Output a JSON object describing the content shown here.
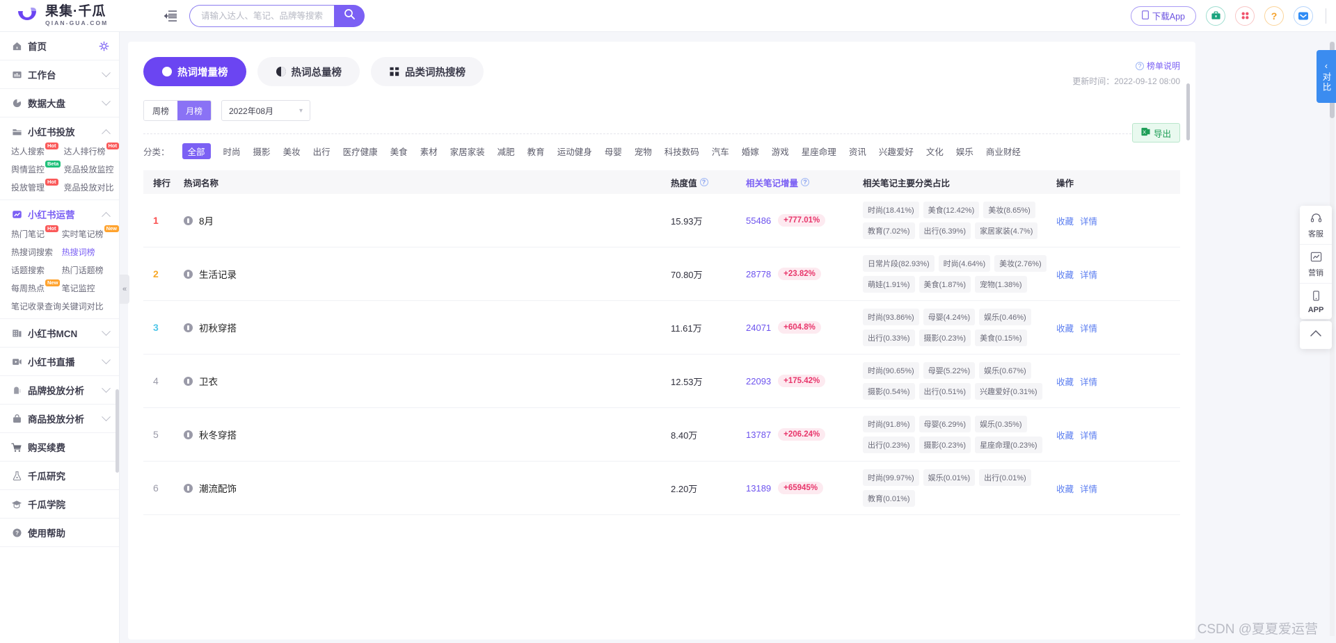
{
  "brand": {
    "cn": "果集·千瓜",
    "en": "QIAN-GUA.COM",
    "logo_icon": "swoosh-logo-icon"
  },
  "header": {
    "collapse_icon": "menu-collapse-icon",
    "search": {
      "placeholder": "请输入达人、笔记、品牌等搜索",
      "value": "",
      "icon": "search-icon"
    },
    "download_app": {
      "label": "下载App",
      "icon": "mobile-icon"
    },
    "icons": [
      {
        "name": "briefcase-icon",
        "color": "#19a37e"
      },
      {
        "name": "grid-dots-icon",
        "color": "#f0526b"
      },
      {
        "name": "question-icon",
        "color": "#f5a22b"
      },
      {
        "name": "mail-icon",
        "color": "#2f8cf5"
      }
    ]
  },
  "sidebar": {
    "groups": [
      {
        "label": "首页",
        "icon": "home-icon",
        "type": "link",
        "accessory": "gear-icon",
        "items": []
      },
      {
        "label": "工作台",
        "icon": "workbench-icon",
        "type": "collapsed",
        "items": []
      },
      {
        "label": "数据大盘",
        "icon": "pie-chart-icon",
        "type": "collapsed",
        "items": []
      },
      {
        "label": "小红书投放",
        "icon": "folder-icon",
        "type": "expanded",
        "items": [
          {
            "label": "达人搜索",
            "badge": "Hot",
            "badge_type": "hot"
          },
          {
            "label": "达人排行榜",
            "badge": "Hot",
            "badge_type": "hot"
          },
          {
            "label": "舆情监控",
            "badge": "Beta",
            "badge_type": "beta"
          },
          {
            "label": "竞品投放监控",
            "badge": "",
            "badge_type": ""
          },
          {
            "label": "投放管理",
            "badge": "Hot",
            "badge_type": "hot"
          },
          {
            "label": "竞品投放对比",
            "badge": "",
            "badge_type": ""
          }
        ]
      },
      {
        "label": "小红书运营",
        "icon": "chart-up-icon",
        "type": "expanded",
        "active": true,
        "items": [
          {
            "label": "热门笔记",
            "badge": "Hot",
            "badge_type": "hot"
          },
          {
            "label": "实时笔记榜",
            "badge": "New",
            "badge_type": "new"
          },
          {
            "label": "热搜词搜索",
            "badge": "",
            "badge_type": ""
          },
          {
            "label": "热搜词榜",
            "badge": "",
            "badge_type": "",
            "current": true
          },
          {
            "label": "话题搜索",
            "badge": "",
            "badge_type": ""
          },
          {
            "label": "热门话题榜",
            "badge": "",
            "badge_type": ""
          },
          {
            "label": "每周热点",
            "badge": "New",
            "badge_type": "new"
          },
          {
            "label": "笔记监控",
            "badge": "",
            "badge_type": ""
          },
          {
            "label": "笔记收录查询",
            "badge": "",
            "badge_type": ""
          },
          {
            "label": "关键词对比",
            "badge": "",
            "badge_type": ""
          }
        ]
      },
      {
        "label": "小红书MCN",
        "icon": "building-icon",
        "type": "collapsed",
        "items": []
      },
      {
        "label": "小红书直播",
        "icon": "video-icon",
        "type": "collapsed",
        "items": []
      },
      {
        "label": "品牌投放分析",
        "icon": "tag-icon",
        "type": "collapsed",
        "items": []
      },
      {
        "label": "商品投放分析",
        "icon": "bag-icon",
        "type": "collapsed",
        "items": []
      },
      {
        "label": "购买续费",
        "icon": "cart-icon",
        "type": "link",
        "items": []
      },
      {
        "label": "千瓜研究",
        "icon": "flask-icon",
        "type": "link",
        "items": []
      },
      {
        "label": "千瓜学院",
        "icon": "graduation-icon",
        "type": "link",
        "items": []
      },
      {
        "label": "使用帮助",
        "icon": "help-circle-icon",
        "type": "link",
        "items": []
      }
    ],
    "collapse_handle_icon": "double-chevron-left-icon"
  },
  "content": {
    "tabs": [
      {
        "label": "热词增量榜",
        "icon": "arrow-up-circle-icon",
        "active": true
      },
      {
        "label": "热词总量榜",
        "icon": "circle-half-icon",
        "active": false
      },
      {
        "label": "品类词热搜榜",
        "icon": "grid-squares-icon",
        "active": false
      }
    ],
    "period": {
      "options": [
        "周榜",
        "月榜"
      ],
      "selected": "月榜"
    },
    "month": {
      "value": "2022年08月",
      "icon": "chevron-down-icon"
    },
    "export": {
      "label": "导出",
      "icon": "excel-icon"
    },
    "rank_note": {
      "label": "榜单说明",
      "icon": "question-circle-icon"
    },
    "update_time": "更新时间：2022-09-12 08:00",
    "category_label": "分类：",
    "categories": [
      "全部",
      "时尚",
      "摄影",
      "美妆",
      "出行",
      "医疗健康",
      "美食",
      "素材",
      "家居家装",
      "减肥",
      "教育",
      "运动健身",
      "母婴",
      "宠物",
      "科技数码",
      "汽车",
      "婚嫁",
      "游戏",
      "星座命理",
      "资讯",
      "兴趣爱好",
      "文化",
      "娱乐",
      "商业财经"
    ],
    "selected_category": "全部",
    "table": {
      "columns": [
        "排行",
        "热词名称",
        "热度值",
        "相关笔记增量",
        "相关笔记主要分类占比",
        "操作"
      ],
      "actions": [
        "收藏",
        "详情"
      ],
      "rows": [
        {
          "rank": "1",
          "word": "8月",
          "heat": "15.93万",
          "increment": "55486",
          "pct": "+777.01%",
          "tags": [
            "时尚(18.41%)",
            "美食(12.42%)",
            "美妆(8.65%)",
            "教育(7.02%)",
            "出行(6.39%)",
            "家居家装(4.7%)"
          ]
        },
        {
          "rank": "2",
          "word": "生活记录",
          "heat": "70.80万",
          "increment": "28778",
          "pct": "+23.82%",
          "tags": [
            "日常片段(82.93%)",
            "时尚(4.64%)",
            "美妆(2.76%)",
            "萌娃(1.91%)",
            "美食(1.87%)",
            "宠物(1.38%)"
          ]
        },
        {
          "rank": "3",
          "word": "初秋穿搭",
          "heat": "11.61万",
          "increment": "24071",
          "pct": "+604.8%",
          "tags": [
            "时尚(93.86%)",
            "母婴(4.24%)",
            "娱乐(0.46%)",
            "出行(0.33%)",
            "摄影(0.23%)",
            "美食(0.15%)"
          ]
        },
        {
          "rank": "4",
          "word": "卫衣",
          "heat": "12.53万",
          "increment": "22093",
          "pct": "+175.42%",
          "tags": [
            "时尚(90.65%)",
            "母婴(5.22%)",
            "娱乐(0.67%)",
            "摄影(0.54%)",
            "出行(0.51%)",
            "兴趣爱好(0.31%)"
          ]
        },
        {
          "rank": "5",
          "word": "秋冬穿搭",
          "heat": "8.40万",
          "increment": "13787",
          "pct": "+206.24%",
          "tags": [
            "时尚(91.8%)",
            "母婴(6.29%)",
            "娱乐(0.35%)",
            "出行(0.23%)",
            "摄影(0.23%)",
            "星座命理(0.23%)"
          ]
        },
        {
          "rank": "6",
          "word": "潮流配饰",
          "heat": "2.20万",
          "increment": "13189",
          "pct": "+65945%",
          "tags": [
            "时尚(99.97%)",
            "娱乐(0.01%)",
            "出行(0.01%)",
            "教育(0.01%)"
          ]
        }
      ]
    }
  },
  "rails": {
    "compare": {
      "label": "对比",
      "icon": "chevron-left-icon"
    },
    "items": [
      {
        "label": "客服",
        "icon": "headset-icon"
      },
      {
        "label": "营销",
        "icon": "chart-line-icon"
      },
      {
        "label": "APP",
        "icon": "mobile-icon"
      }
    ],
    "back_to_top_icon": "arrow-up-icon"
  },
  "watermark": "CSDN @夏夏爱运营",
  "colors": {
    "primary": "#7b60f4",
    "tab_active": "#6b45f2",
    "increment": "#6d53ee",
    "pct": "#e8366b",
    "compare": "#3b8cf0"
  }
}
